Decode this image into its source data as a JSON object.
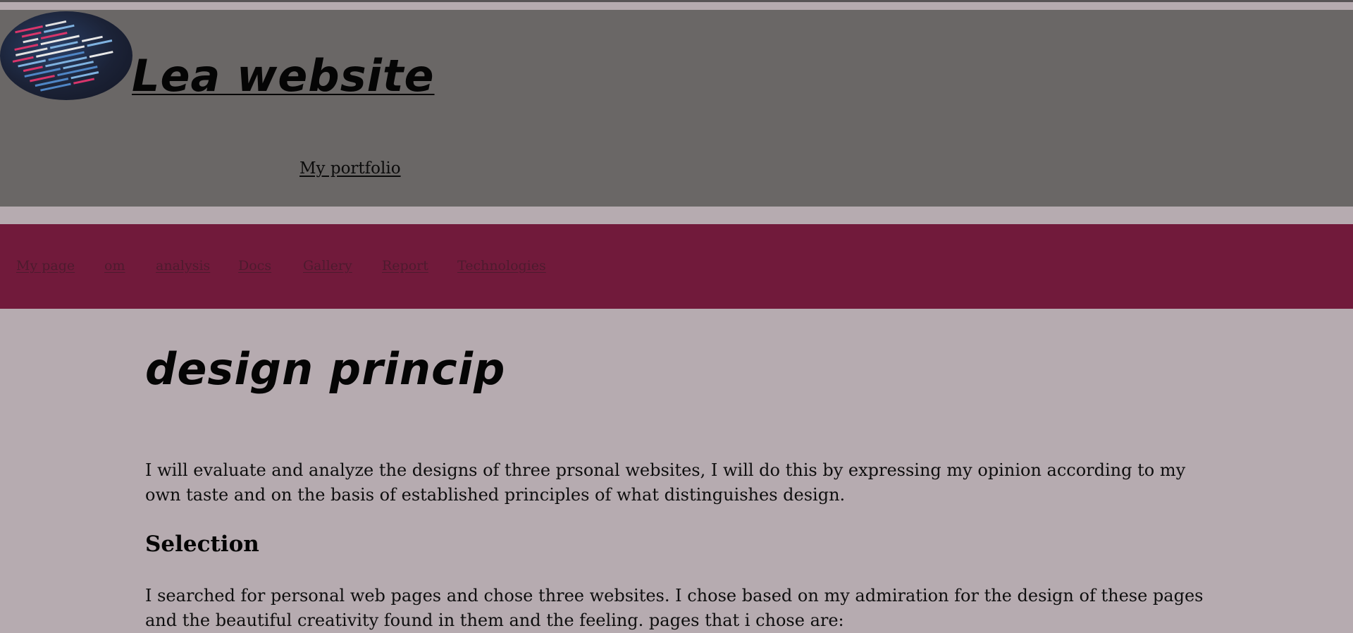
{
  "header": {
    "site_title": "Lea website",
    "portfolio_link": "My portfolio",
    "logo_icon": "code-screen-logo"
  },
  "nav": {
    "items": [
      {
        "label": "My page"
      },
      {
        "label": "om"
      },
      {
        "label": "analysis"
      },
      {
        "label": "Docs"
      },
      {
        "label": "Gallery"
      },
      {
        "label": "Report"
      },
      {
        "label": "Technologies"
      }
    ]
  },
  "main": {
    "title": "design princip",
    "intro": "I will evaluate and analyze the designs of three prsonal websites, I will do this by expressing my opinion according to my own taste and on the basis of established principles of what distinguishes design.",
    "selection_heading": "Selection",
    "selection_text": "I searched for personal web pages and chose three websites. I chose based on my admiration for the design of these pages and the beautiful creativity found in them and the feeling. pages that i chose are:"
  },
  "colors": {
    "page_background": "#b6abb0",
    "header_background": "#6a6766",
    "nav_background": "#711a3b",
    "nav_link": "#4d1a2e"
  }
}
